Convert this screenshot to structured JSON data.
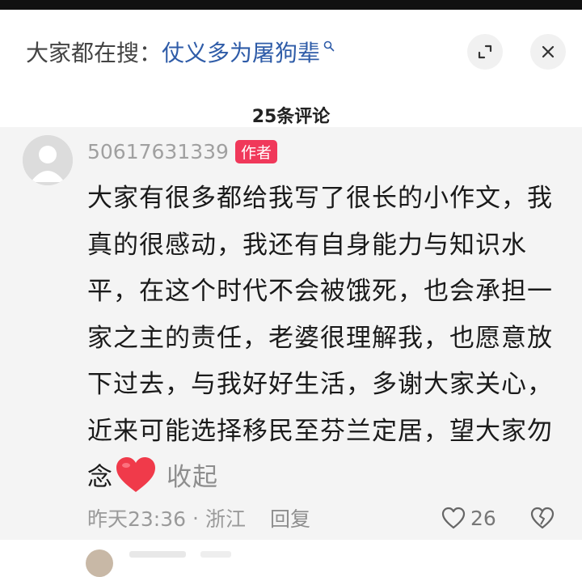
{
  "header": {
    "search_prefix": "大家都在搜：",
    "search_query": "仗义多为屠狗辈",
    "icons": [
      "search-icon",
      "expand-icon",
      "close-icon"
    ]
  },
  "comments_header": {
    "count_label": "25条评论"
  },
  "comment": {
    "username": "50617631339",
    "author_badge": "作者",
    "text": "大家有很多都给我写了很长的小作文，我真的很感动，我还有自身能力与知识水平，在这个时代不会被饿死，也会承担一家之主的责任，老婆很理解我，也愿意放下过去，与我好好生活，多谢大家关心，近来可能选择移民至芬兰定居，望大家勿念",
    "emoji": "red-heart-emoji",
    "collapse_label": "收起",
    "timestamp": "昨天23:36",
    "separator": "·",
    "location": "浙江",
    "reply_label": "回复",
    "like_count": "26"
  },
  "colors": {
    "link_blue": "#2f5ca8",
    "badge_red": "#f0385a",
    "comment_bg": "#f4f4f4",
    "heart_red": "#f03a4a"
  }
}
